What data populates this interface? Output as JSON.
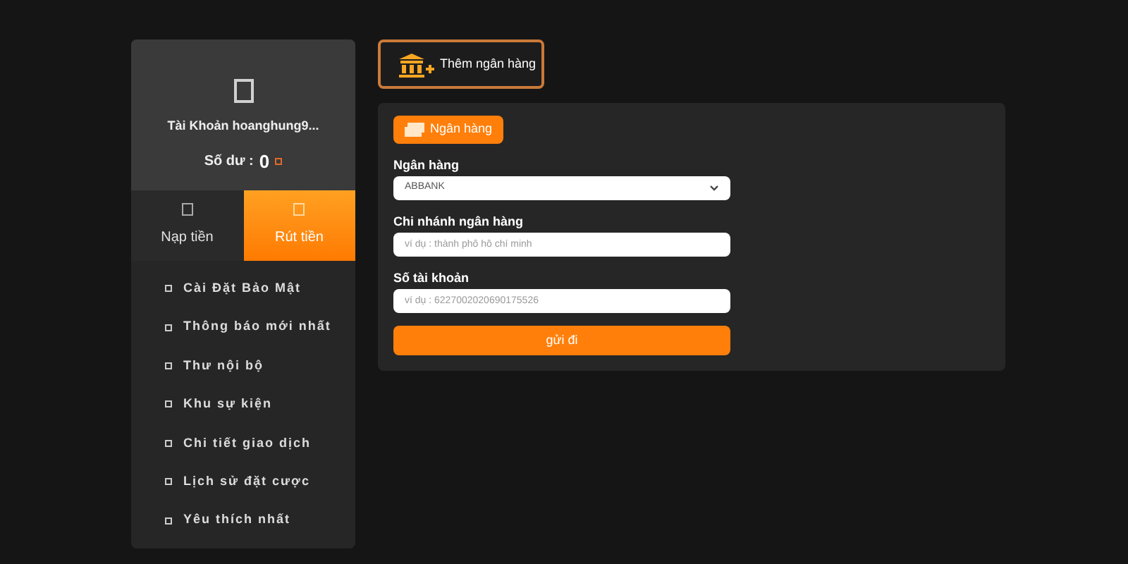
{
  "profile": {
    "account": "Tài Khoản hoanghung9...",
    "balance_label": "Số dư :",
    "balance": "0"
  },
  "tabs": [
    {
      "label": "Nạp tiền",
      "selected": false
    },
    {
      "label": "Rút tiền",
      "selected": true
    }
  ],
  "menu": [
    "Cài Đặt Bảo Mật",
    "Thông báo mới nhất",
    "Thư nội bộ",
    "Khu sự kiện",
    "Chi tiết giao dịch",
    "Lịch sử đặt cược",
    "Yêu thích nhất"
  ],
  "add_bank_button": "Thêm ngân hàng",
  "form": {
    "tab": "Ngân hàng",
    "fields": [
      {
        "kind": "select",
        "label": "Ngân hàng",
        "value": "ABBANK"
      },
      {
        "kind": "input",
        "label": "Chi nhánh ngân hàng",
        "placeholder": "ví dụ : thành phố hồ chí minh"
      },
      {
        "kind": "input",
        "label": "Số tài khoản",
        "placeholder": "ví dụ : 6227002020690175526"
      }
    ],
    "submit": "gửi đi"
  }
}
